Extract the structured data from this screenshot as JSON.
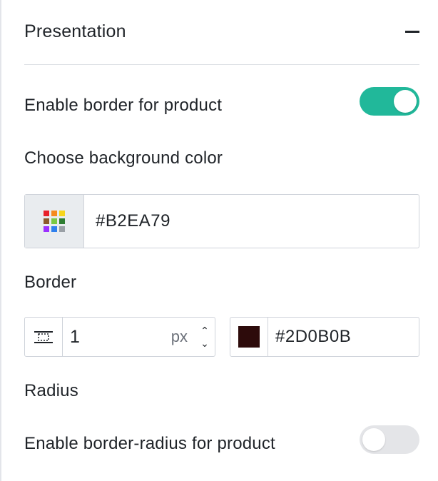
{
  "section": {
    "title": "Presentation",
    "collapse_icon": "minus-icon"
  },
  "border_toggle": {
    "label": "Enable border for product",
    "on": true
  },
  "background": {
    "label": "Choose background color",
    "value": "#B2EA79",
    "picker_icon": "color-palette-icon",
    "palette_colors": [
      "#e8202a",
      "#f58a1f",
      "#f7d51c",
      "#8b5a2b",
      "#7ac943",
      "#2e7d32",
      "#9b30ff",
      "#2f80ed",
      "#9aa0a6"
    ]
  },
  "border": {
    "label": "Border",
    "width_icon": "border-style-icon",
    "width_value": "1",
    "unit": "px",
    "stepper_up": "⌃",
    "stepper_down": "⌄",
    "color_value": "#2D0B0B",
    "swatch_color": "#2d0b0b"
  },
  "radius": {
    "label": "Radius",
    "toggle_label": "Enable border-radius for product",
    "on": false
  },
  "colors": {
    "accent": "#21b89a"
  }
}
